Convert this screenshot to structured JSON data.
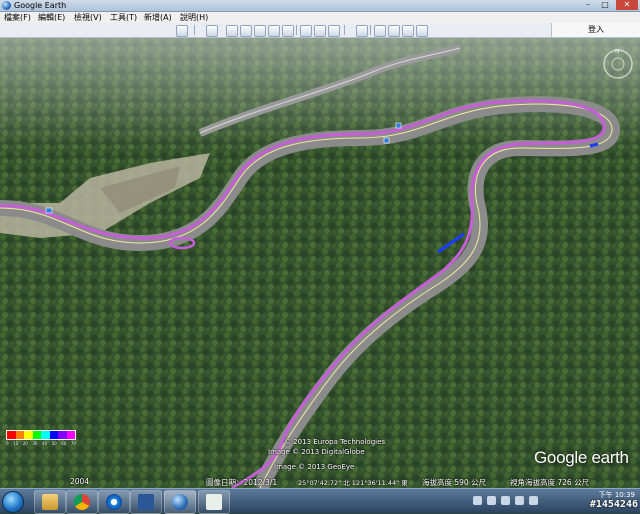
{
  "window": {
    "title": "Google Earth",
    "minimize": "–",
    "maximize": "□",
    "close": "✕"
  },
  "menu": [
    "檔案(F)",
    "編輯(E)",
    "檢視(V)",
    "工具(T)",
    "新增(A)",
    "說明(H)"
  ],
  "toolbar": {
    "login_label": "登入"
  },
  "map": {
    "copyright_1": "© 2013 Europa Technologies",
    "copyright_2": "Image © 2013 DigitalGlobe",
    "copyright_3": "Image © 2013 GeoEye",
    "logo": "Google earth",
    "status": {
      "imagery_date": "圖像日期：2012/3/1",
      "coordinates": "25°07'42.72\" 北  121°36'11.44\" 東",
      "elevation": "海拔高度  590 公尺",
      "eye_altitude": "視角海拔高度  726 公尺",
      "corner_value": "2004"
    },
    "legend_ticks": [
      "0",
      "10",
      "20",
      "30",
      "40",
      "50",
      "60",
      "70"
    ],
    "legend_colors": [
      "#ff0000",
      "#ff8000",
      "#ffff00",
      "#00ff00",
      "#00ffff",
      "#0000ff",
      "#8000ff",
      "#ff00ff"
    ]
  },
  "taskbar": {
    "apps": [
      "folder",
      "chrome",
      "internet-explorer",
      "word",
      "google-earth",
      "eye-app"
    ],
    "clock_time": "10:39",
    "clock_label": "下午",
    "ticket": "#1454246"
  },
  "colors": {
    "track": "#c55fd6",
    "track_highlight": "#1c3cff",
    "road": "#9a9a9a"
  }
}
